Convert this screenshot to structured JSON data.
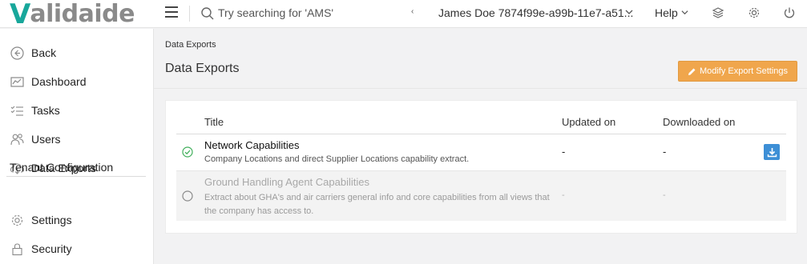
{
  "app": {
    "logo_initial": "V",
    "logo_rest": "alidaide",
    "brand_color": "#18a79b"
  },
  "topbar": {
    "search_placeholder": "Try searching for 'AMS'",
    "search_caret": "‹",
    "user_label": "James Doe 7874f99e-a99b-11e7-a51...",
    "help_label": "Help",
    "icons": [
      "menu-icon",
      "search-icon",
      "chevron-down-icon",
      "layers-icon",
      "gear-icon",
      "power-icon"
    ]
  },
  "sidebar": {
    "items": [
      {
        "label": "Back",
        "icon": "back-arrow-icon"
      },
      {
        "label": "Dashboard",
        "icon": "dashboard-icon"
      },
      {
        "label": "Tasks",
        "icon": "tasks-icon"
      },
      {
        "label": "Users",
        "icon": "users-icon"
      },
      {
        "label": "Data Exports",
        "icon": "cloud-download-icon"
      }
    ],
    "section_title": "Tenant Configuration",
    "config_items": [
      {
        "label": "Settings",
        "icon": "gear-icon"
      },
      {
        "label": "Security",
        "icon": "lock-icon"
      }
    ]
  },
  "main": {
    "breadcrumb": "Data Exports",
    "title": "Data Exports",
    "modify_button": "Modify Export Settings",
    "accent_color": "#f0a64c",
    "table": {
      "columns": [
        "Title",
        "Updated on",
        "Downloaded on"
      ],
      "rows": [
        {
          "title": "Network Capabilities",
          "description": "Company Locations and direct Supplier Locations capability extract.",
          "updated_on": "-",
          "downloaded_on": "-",
          "status": "selected"
        },
        {
          "title": "Ground Handling Agent Capabilities",
          "description": "Extract about GHA's and air carriers general info and core capabilities from all views that the company has access to.",
          "updated_on": "-",
          "downloaded_on": "-",
          "status": "disabled"
        }
      ]
    }
  }
}
